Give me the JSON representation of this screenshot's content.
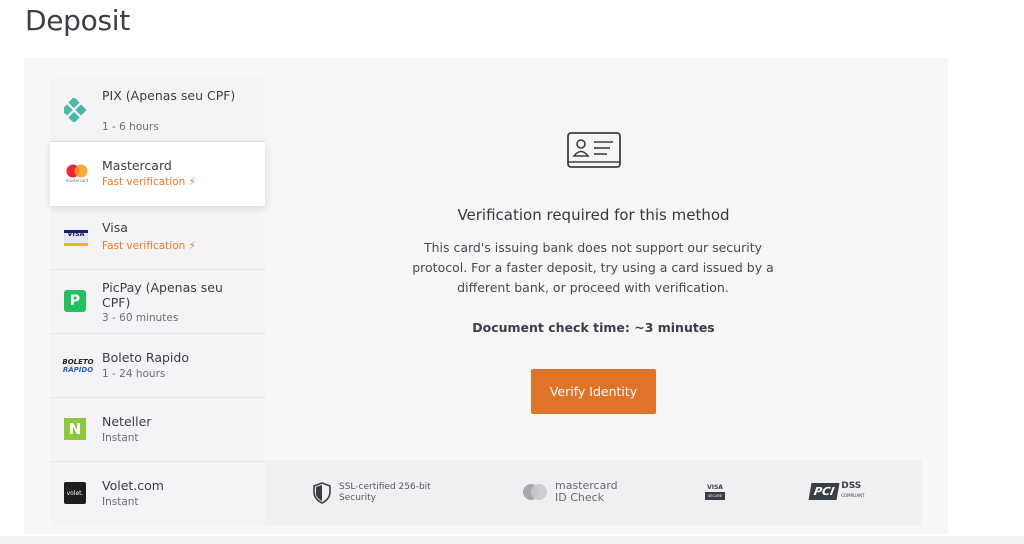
{
  "page": {
    "title": "Deposit"
  },
  "methods": [
    {
      "name": "PIX (Apenas seu CPF)",
      "sub": "1 - 6 hours",
      "icon": "pix-icon",
      "fast": false
    },
    {
      "name": "Mastercard",
      "sub": "Fast verification",
      "icon": "mastercard-icon",
      "fast": true,
      "selected": true
    },
    {
      "name": "Visa",
      "sub": "Fast verification",
      "icon": "visa-icon",
      "fast": true
    },
    {
      "name": "PicPay (Apenas seu CPF)",
      "sub": "3 - 60 minutes",
      "icon": "picpay-icon",
      "fast": false
    },
    {
      "name": "Boleto Rapido",
      "sub": "1 - 24 hours",
      "icon": "boleto-icon",
      "fast": false
    },
    {
      "name": "Neteller",
      "sub": "Instant",
      "icon": "neteller-icon",
      "fast": false
    },
    {
      "name": "Volet.com",
      "sub": "Instant",
      "icon": "volet-icon",
      "fast": false
    }
  ],
  "icon_text": {
    "mastercard_small": "mastercard",
    "visa": "VISA",
    "boleto_line1": "BOLETO",
    "boleto_line2": "RÁPIDO",
    "neteller": "N",
    "volet": "volet.",
    "picpay": "P"
  },
  "verification": {
    "heading": "Verification required for this method",
    "description": "This card's issuing bank does not support our security protocol. For a faster deposit, try using a card issued by a different bank, or proceed with verification.",
    "check_time": "Document check time: ~3 minutes",
    "button_label": "Verify Identity"
  },
  "footer": {
    "ssl_text": "SSL-certified 256-bit Security",
    "mastercard_line1": "mastercard",
    "mastercard_line2": "ID Check",
    "visa_secure_line1": "VISA",
    "visa_secure_line2": "SECURE",
    "pci_line1": "PCI",
    "pci_line2": "DSS",
    "pci_line3": "COMPLIANT"
  },
  "colors": {
    "accent": "#e0732a",
    "fast_text": "#e27b2c",
    "pix": "#4bb8a9",
    "mastercard_red": "#eb001b",
    "mastercard_yellow": "#f79e1b",
    "neteller": "#8dc63f",
    "picpay": "#21c25e"
  }
}
